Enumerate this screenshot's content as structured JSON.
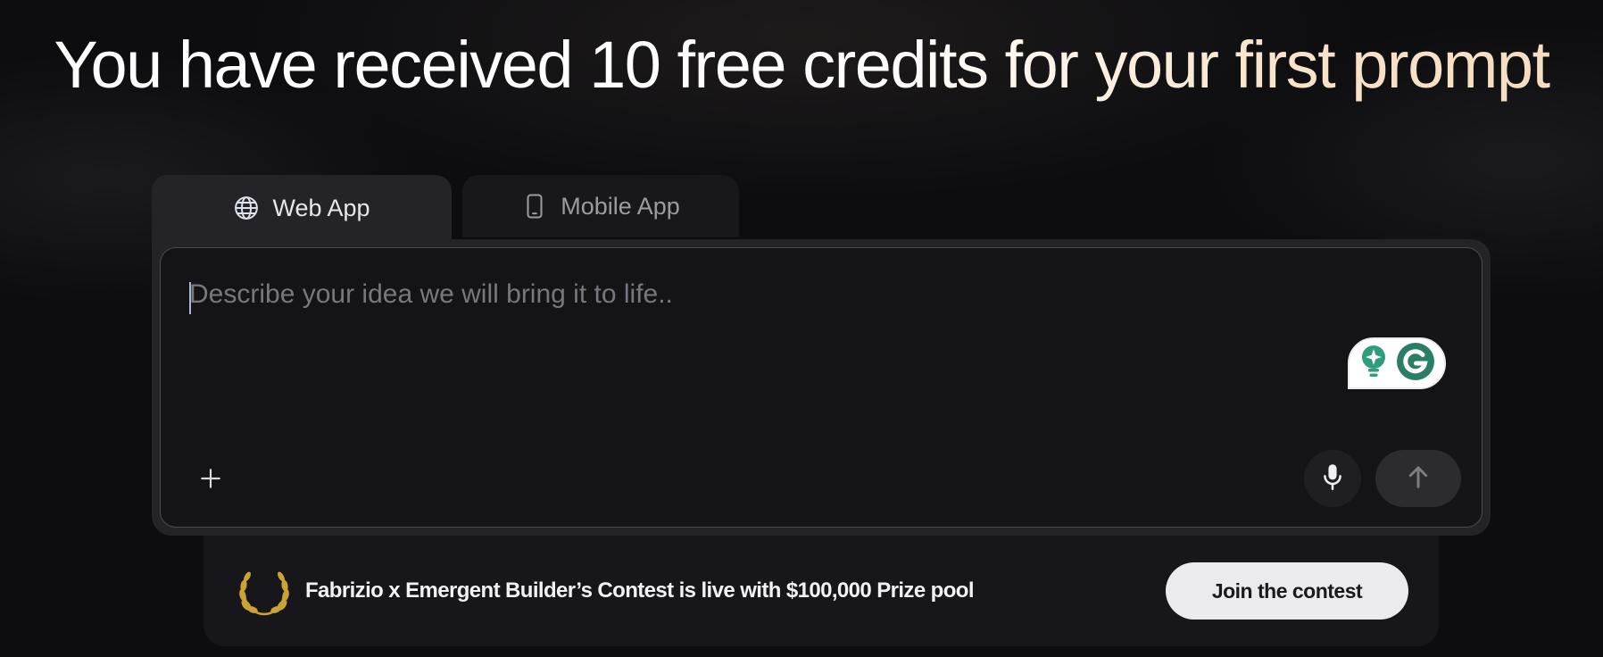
{
  "headline": "You have received 10 free credits for your first prompt",
  "tabs": [
    {
      "label": "Web App",
      "icon": "globe-icon",
      "active": true
    },
    {
      "label": "Mobile App",
      "icon": "smartphone-icon",
      "active": false
    }
  ],
  "prompt": {
    "value": "",
    "placeholder": "Describe your idea we will bring it to life.."
  },
  "toolbar": {
    "attach_icon": "plus-icon",
    "mic_icon": "microphone-icon",
    "send_icon": "arrow-up-icon",
    "grammarly_icons": [
      "lightbulb-icon",
      "grammarly-logo-icon"
    ]
  },
  "banner": {
    "icon": "laurel-wreath-icon",
    "text": "Fabrizio x Emergent Builder’s Contest is live with $100,000 Prize pool",
    "button_label": "Join the contest"
  },
  "colors": {
    "background": "#0d0d10",
    "panel": "#232328",
    "input_bg": "#141417",
    "accent_gold": "#c9a433",
    "grammarly_green": "#2f8f72",
    "button_light": "#ebebef"
  }
}
